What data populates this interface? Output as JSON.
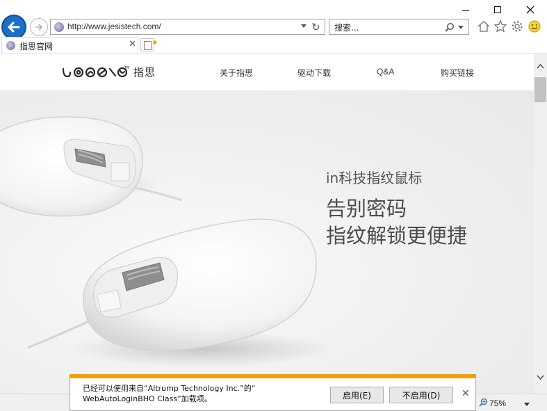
{
  "browser": {
    "address": "http://www.jesistech.com/",
    "search_placeholder": "搜索...",
    "tab_title": "指思官网",
    "zoom": "75%"
  },
  "site": {
    "logo_text": "指思",
    "nav": [
      "关于指思",
      "驱动下载",
      "Q&A",
      "购买链接"
    ]
  },
  "hero": {
    "subtitle": "in科技指纹鼠标",
    "title_line1": "告别密码",
    "title_line2": "指纹解锁更便捷"
  },
  "notification": {
    "line1": "已经可以使用来自“Altrump Technology Inc.”的“",
    "line2": "WebAutoLoginBHO Class”加载项。",
    "enable_label": "启用(E)",
    "disable_label": "不启用(D)"
  }
}
